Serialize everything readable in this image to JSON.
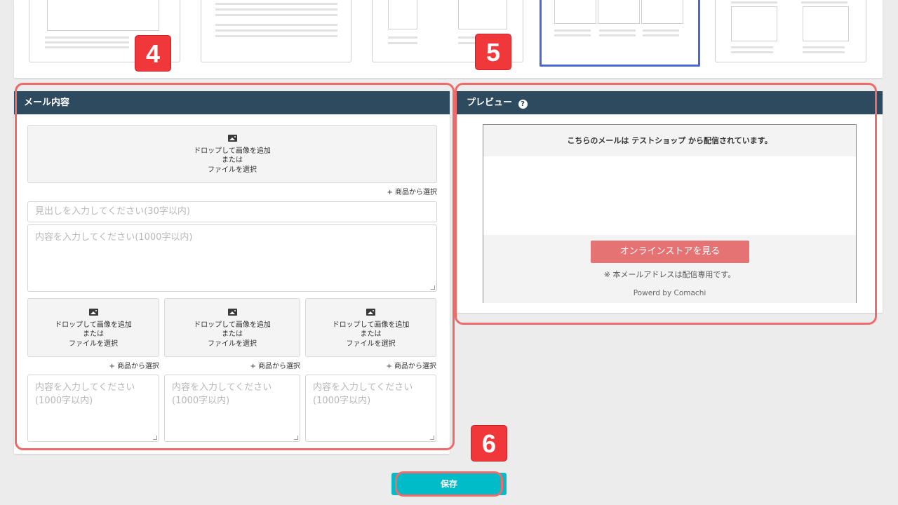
{
  "mail_section": {
    "title": "メール内容",
    "dropzone": {
      "line1": "ドロップして画像を追加",
      "line2": "または",
      "line3": "ファイルを選択"
    },
    "pick_label": "+ 商品から選択",
    "heading_placeholder": "見出しを入力してください(30字以内)",
    "body_placeholder": "内容を入力してください(1000字以内)",
    "col_placeholder_1": "内容を入力してください",
    "col_placeholder_2": "(1000字以内)"
  },
  "preview_section": {
    "title": "プレビュー",
    "help_icon": "?",
    "header_text": "こちらのメールは テストショップ から配信されています。",
    "store_button": "オンラインストアを見る",
    "note": "※ 本メールアドレスは配信専用です。",
    "powered": "Powerd by Comachi"
  },
  "badges": {
    "b4": "4",
    "b5": "5",
    "b6": "6"
  },
  "save_button": "保存",
  "colors": {
    "header": "#2e4a5e",
    "accent": "#00bcc8",
    "store_button": "#e57373",
    "annotation": "#ef6b6b",
    "selected_template": "#4a67d6"
  }
}
